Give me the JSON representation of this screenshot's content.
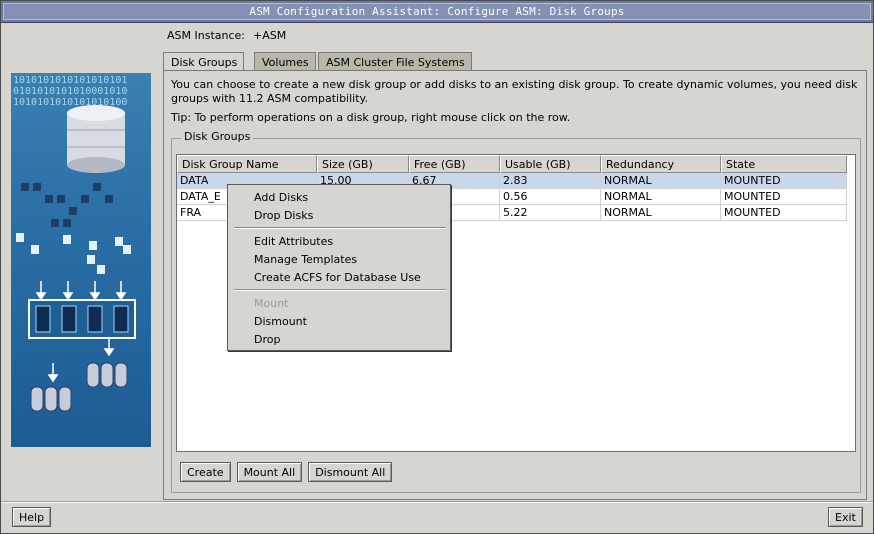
{
  "window": {
    "title": "ASM Configuration Assistant: Configure ASM: Disk Groups"
  },
  "instance": {
    "label": "ASM Instance:",
    "value": "+ASM"
  },
  "tabs": [
    {
      "label": "Disk Groups",
      "active": true
    },
    {
      "label": "Volumes",
      "active": false
    },
    {
      "label": "ASM Cluster File Systems",
      "active": false
    }
  ],
  "panel": {
    "intro": "You can choose to create a new disk group or add disks to an existing disk group. To create dynamic volumes, you need disk groups with 11.2 ASM compatibility.",
    "tip": "Tip: To perform operations on a disk group, right mouse click on the row.",
    "group_label": "Disk Groups"
  },
  "table": {
    "columns": [
      "Disk Group Name",
      "Size (GB)",
      "Free (GB)",
      "Usable (GB)",
      "Redundancy",
      "State"
    ],
    "rows": [
      [
        "DATA",
        "15.00",
        "6.67",
        "2.83",
        "NORMAL",
        "MOUNTED"
      ],
      [
        "DATA_E",
        "",
        "",
        "0.56",
        "NORMAL",
        "MOUNTED"
      ],
      [
        "FRA",
        "",
        "",
        "5.22",
        "NORMAL",
        "MOUNTED"
      ]
    ]
  },
  "buttons": {
    "create": "Create",
    "mount_all": "Mount All",
    "dismount_all": "Dismount All",
    "help": "Help",
    "exit": "Exit"
  },
  "context_menu": {
    "items": [
      {
        "label": "Add Disks",
        "enabled": true
      },
      {
        "label": "Drop Disks",
        "enabled": true
      },
      {
        "label": "Edit Attributes",
        "enabled": true
      },
      {
        "label": "Manage Templates",
        "enabled": true
      },
      {
        "label": "Create ACFS for Database Use",
        "enabled": true
      },
      {
        "label": "Mount",
        "enabled": false
      },
      {
        "label": "Dismount",
        "enabled": true
      },
      {
        "label": "Drop",
        "enabled": true
      }
    ]
  },
  "decor": {
    "binary_lines": [
      "1010101010101010101",
      "0101010101010001010",
      "1010101010101010100"
    ]
  },
  "colors": {
    "selection": "#c9d7ea",
    "titlebar": "#6d7aa0",
    "image_blue": "#2a6fa6"
  }
}
